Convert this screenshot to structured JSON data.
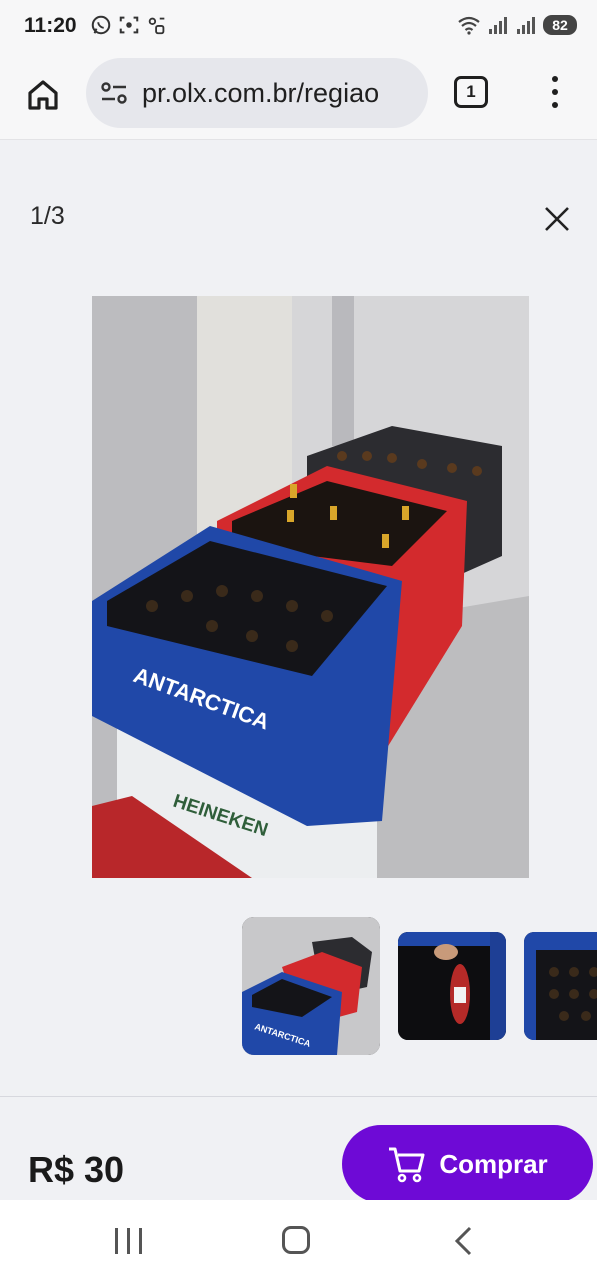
{
  "status_bar": {
    "time": "11:20",
    "battery": "82",
    "icons": [
      "whatsapp-icon",
      "screenshot-icon",
      "voicemail-icon",
      "wifi-icon",
      "signal-icon",
      "signal-icon",
      "battery-icon"
    ]
  },
  "browser": {
    "url": "pr.olx.com.br/regiao",
    "tab_count": "1",
    "icons": [
      "home-icon",
      "site-settings-icon",
      "tabs-icon",
      "more-vert-icon"
    ]
  },
  "gallery": {
    "counter": "1/3",
    "close_icon": "close-icon",
    "thumbnails": [
      "thumbnail-1",
      "thumbnail-2",
      "thumbnail-3"
    ]
  },
  "listing": {
    "price": "R$ 30",
    "buy_label": "Comprar",
    "buy_icon": "cart-icon",
    "accent_color": "#6e0ad6"
  },
  "nav_bar": {
    "icons": [
      "recents-icon",
      "home-icon",
      "back-icon"
    ]
  }
}
